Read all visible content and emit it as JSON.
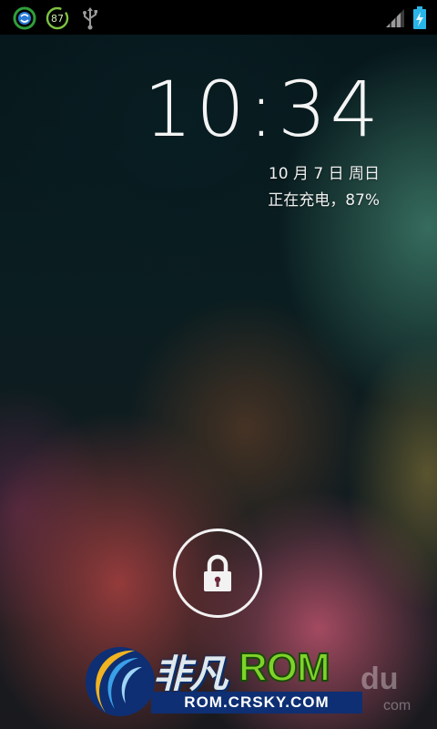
{
  "status_bar": {
    "left_icons": [
      "sync-icon",
      "battery-saver-icon",
      "usb-icon"
    ],
    "battery_saver_value": "87",
    "right_icons": [
      "signal-icon",
      "battery-charging-icon"
    ]
  },
  "lockscreen": {
    "time": "10:34",
    "date": "10 月 7 日 周日",
    "charging_status": "正在充电，87%",
    "lock_icon": "lock-icon"
  },
  "watermark": {
    "brand_cn": "非凡",
    "brand_rom": "ROM",
    "url": "ROM.CRSKY.COM",
    "baidu_du": "du",
    "baidu_com": "com"
  },
  "colors": {
    "status_bar_bg": "#000000",
    "sync_blue": "#2a7bd6",
    "green_badge": "#7ec242",
    "battery_cyan": "#2ab5e8",
    "brand_green": "#7fd22a",
    "brand_navy": "#0e2f73"
  }
}
